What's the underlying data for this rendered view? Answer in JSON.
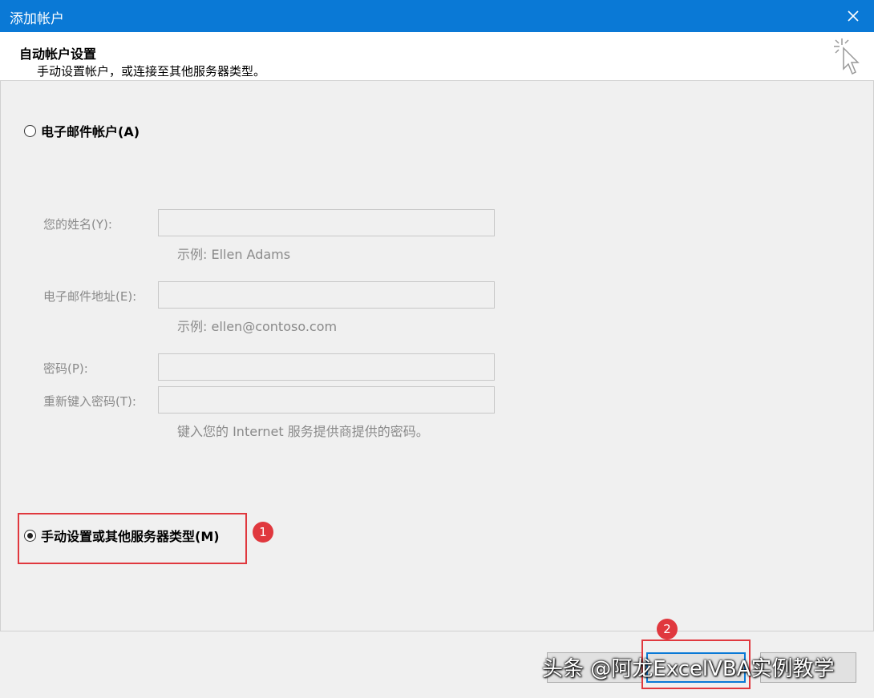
{
  "window": {
    "title": "添加帐户"
  },
  "header": {
    "title": "自动帐户设置",
    "subtitle": "手动设置帐户，或连接至其他服务器类型。",
    "icon": "wizard-cursor-icon"
  },
  "options": {
    "email_account": {
      "label": "电子邮件帐户(A)",
      "selected": false
    },
    "manual_setup": {
      "label": "手动设置或其他服务器类型(M)",
      "selected": true
    }
  },
  "form": {
    "name_label": "您的姓名(Y):",
    "name_value": "",
    "name_hint": "示例: Ellen Adams",
    "email_label": "电子邮件地址(E):",
    "email_value": "",
    "email_hint": "示例: ellen@contoso.com",
    "password_label": "密码(P):",
    "password_value": "",
    "retype_label": "重新键入密码(T):",
    "retype_value": "",
    "password_hint": "键入您的 Internet 服务提供商提供的密码。"
  },
  "annotations": {
    "badge1": "1",
    "badge2": "2"
  },
  "buttons": {
    "back_label": "",
    "next_label": "",
    "cancel_label": ""
  },
  "watermark": "头条 @阿龙ExcelVBA实例教学",
  "colors": {
    "titlebar": "#0a79d6",
    "annotation": "#e0383e"
  }
}
